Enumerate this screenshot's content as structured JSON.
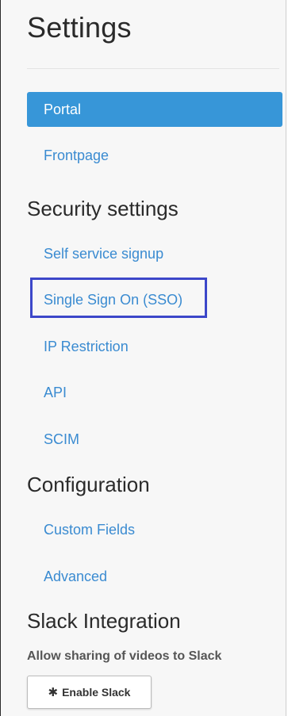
{
  "title": "Settings",
  "nav": {
    "portal": "Portal",
    "frontpage": "Frontpage"
  },
  "security": {
    "heading": "Security settings",
    "items": [
      "Self service signup",
      "Single Sign On (SSO)",
      "IP Restriction",
      "API",
      "SCIM"
    ]
  },
  "configuration": {
    "heading": "Configuration",
    "items": [
      "Custom Fields",
      "Advanced"
    ]
  },
  "slack": {
    "heading": "Slack Integration",
    "description": "Allow sharing of videos to Slack",
    "button_icon": "slack-icon",
    "button_label": "Enable Slack"
  },
  "colors": {
    "accent": "#3796d8",
    "link": "#3a8bd1",
    "highlight_box": "#3c47c9"
  }
}
